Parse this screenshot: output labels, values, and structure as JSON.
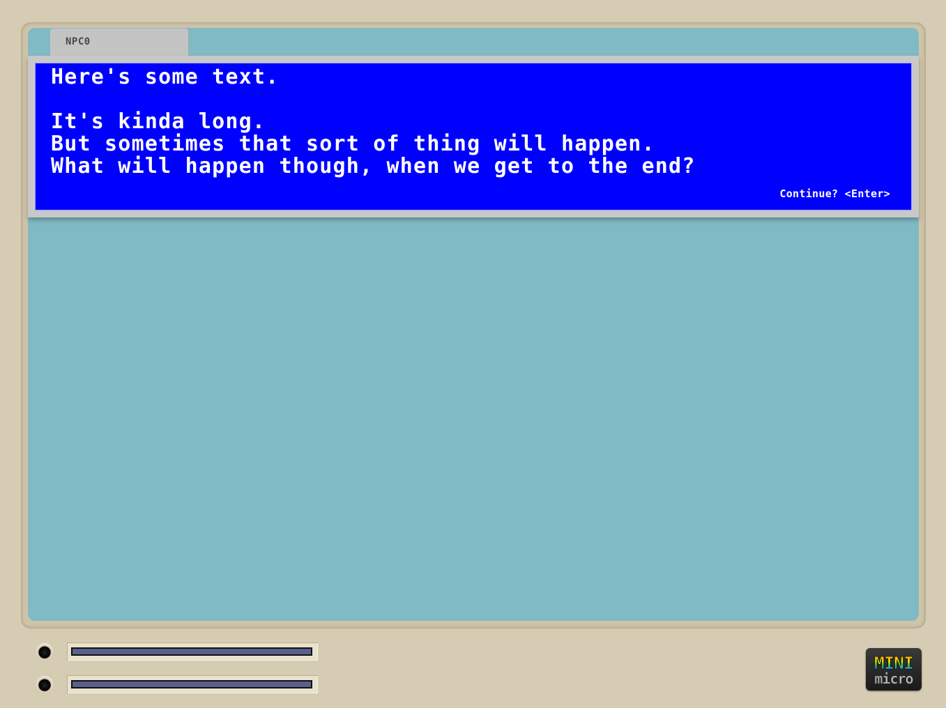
{
  "window": {
    "tab_label": "NPC0"
  },
  "dialog": {
    "lines": [
      "Here's some text.",
      "",
      "It's kinda long.",
      "But sometimes that sort of thing will happen.",
      "What will happen though, when we get to the end?"
    ],
    "continue_prompt": "Continue? <Enter>"
  },
  "indicators": [
    {
      "led": "off",
      "bar_icon": "disk-slot-icon"
    },
    {
      "led": "off",
      "bar_icon": "disk-slot-icon"
    }
  ],
  "brand": {
    "logo_text_top": "MINI",
    "logo_text_bottom": "micro",
    "logo_icon": "mini-micro-logo"
  },
  "colors": {
    "screen_bg": "#80bac4",
    "dialog_bg": "#0000ff",
    "dialog_text": "#ffffff",
    "bezel": "#d6ccb3",
    "tab_bg": "#c4c4c4"
  }
}
